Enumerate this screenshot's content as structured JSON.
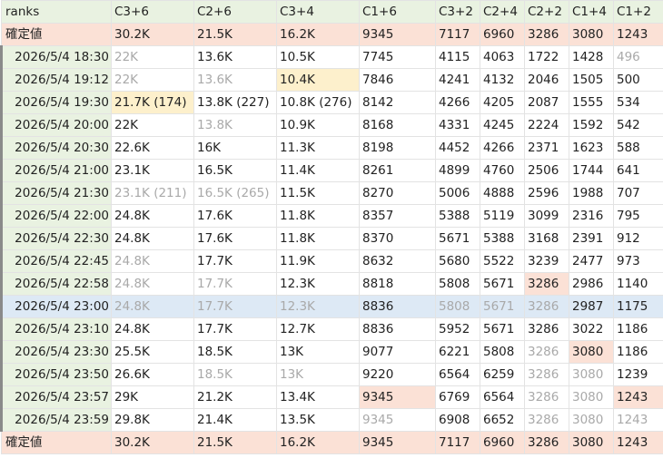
{
  "header": {
    "corner": "ranks",
    "columns": [
      "C3+6",
      "C2+6",
      "C3+4",
      "C1+6",
      "C3+2",
      "C2+4",
      "C2+2",
      "C1+4",
      "C1+2"
    ]
  },
  "final_label": "確定値",
  "final_values": [
    "30.2K",
    "21.5K",
    "16.2K",
    "9345",
    "7117",
    "6960",
    "3286",
    "3080",
    "1243"
  ],
  "rows": [
    {
      "ts": "2026/5/4 18:30",
      "v": [
        "22K",
        "13.6K",
        "10.5K",
        "7745",
        "4115",
        "4063",
        "1722",
        "1428",
        "496"
      ]
    },
    {
      "ts": "2026/5/4 19:12",
      "v": [
        "22K",
        "13.6K",
        "10.4K",
        "7846",
        "4241",
        "4132",
        "2046",
        "1505",
        "500"
      ]
    },
    {
      "ts": "2026/5/4 19:30",
      "v": [
        "21.7K (174)",
        "13.8K (227)",
        "10.8K (276)",
        "8142",
        "4266",
        "4205",
        "2087",
        "1555",
        "534"
      ]
    },
    {
      "ts": "2026/5/4 20:00",
      "v": [
        "22K",
        "13.8K",
        "10.9K",
        "8168",
        "4331",
        "4245",
        "2224",
        "1592",
        "542"
      ]
    },
    {
      "ts": "2026/5/4 20:30",
      "v": [
        "22.6K",
        "16K",
        "11.3K",
        "8198",
        "4452",
        "4266",
        "2371",
        "1623",
        "588"
      ]
    },
    {
      "ts": "2026/5/4 21:00",
      "v": [
        "23.1K",
        "16.5K",
        "11.4K",
        "8261",
        "4899",
        "4760",
        "2506",
        "1744",
        "641"
      ]
    },
    {
      "ts": "2026/5/4 21:30",
      "v": [
        "23.1K (211)",
        "16.5K (265)",
        "11.5K",
        "8270",
        "5006",
        "4888",
        "2596",
        "1988",
        "707"
      ]
    },
    {
      "ts": "2026/5/4 22:00",
      "v": [
        "24.8K",
        "17.6K",
        "11.8K",
        "8357",
        "5388",
        "5119",
        "3099",
        "2316",
        "795"
      ]
    },
    {
      "ts": "2026/5/4 22:30",
      "v": [
        "24.8K",
        "17.6K",
        "11.8K",
        "8370",
        "5671",
        "5388",
        "3168",
        "2391",
        "912"
      ]
    },
    {
      "ts": "2026/5/4 22:45",
      "v": [
        "24.8K",
        "17.7K",
        "11.9K",
        "8632",
        "5680",
        "5522",
        "3239",
        "2477",
        "973"
      ]
    },
    {
      "ts": "2026/5/4 22:58",
      "v": [
        "24.8K",
        "17.7K",
        "12.3K",
        "8818",
        "5808",
        "5671",
        "3286",
        "2986",
        "1140"
      ]
    },
    {
      "ts": "2026/5/4 23:00",
      "v": [
        "24.8K",
        "17.7K",
        "12.3K",
        "8836",
        "5808",
        "5671",
        "3286",
        "2987",
        "1175"
      ]
    },
    {
      "ts": "2026/5/4 23:10",
      "v": [
        "24.8K",
        "17.7K",
        "12.7K",
        "8836",
        "5952",
        "5671",
        "3286",
        "3022",
        "1186"
      ]
    },
    {
      "ts": "2026/5/4 23:30",
      "v": [
        "25.5K",
        "18.5K",
        "13K",
        "9077",
        "6221",
        "5808",
        "3286",
        "3080",
        "1186"
      ]
    },
    {
      "ts": "2026/5/4 23:50",
      "v": [
        "26.6K",
        "18.5K",
        "13K",
        "9220",
        "6564",
        "6259",
        "3286",
        "3080",
        "1239"
      ]
    },
    {
      "ts": "2026/5/4 23:57",
      "v": [
        "29K",
        "21.2K",
        "13.4K",
        "9345",
        "6769",
        "6564",
        "3286",
        "3080",
        "1243"
      ]
    },
    {
      "ts": "2026/5/4 23:59",
      "v": [
        "29.8K",
        "21.4K",
        "13.5K",
        "9345",
        "6908",
        "6652",
        "3286",
        "3080",
        "1243"
      ]
    }
  ],
  "colors": {
    "header_bg": "#e9f2e1",
    "final_bg": "#fbe1d6",
    "highlight_row_bg": "#dde9f5",
    "cell_yellow": "#fdf0cc",
    "cell_orange": "#fbe1d6",
    "muted_text": "#a9a9a9"
  }
}
